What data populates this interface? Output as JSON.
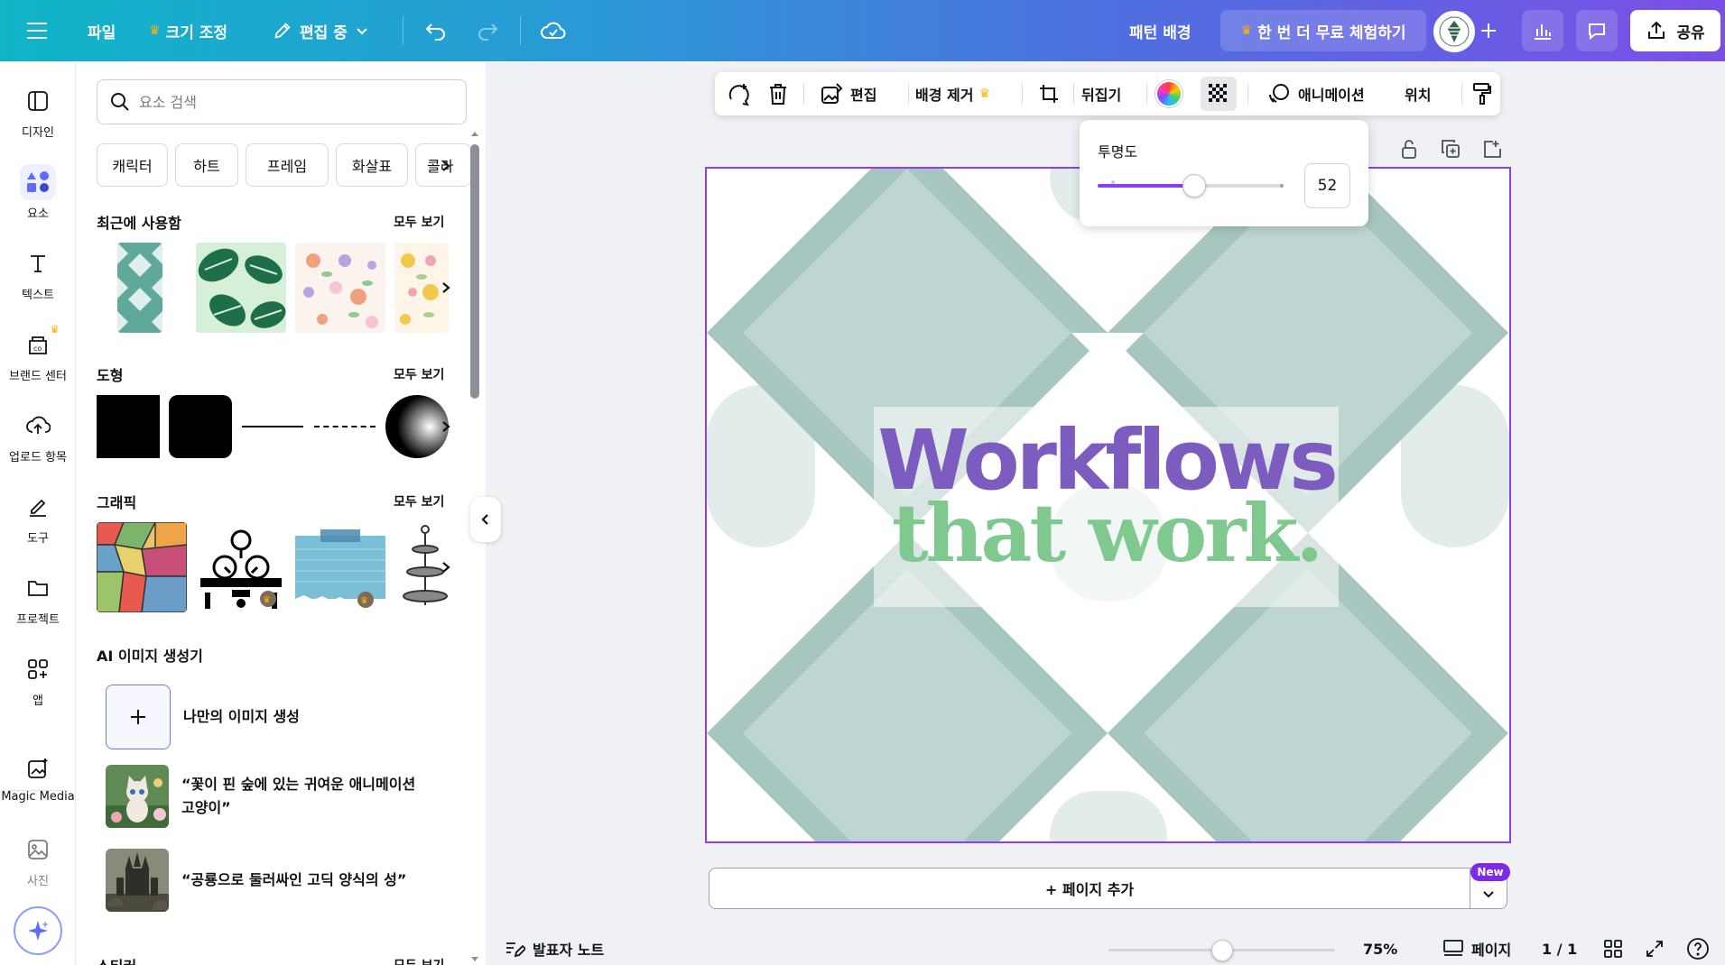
{
  "topbar": {
    "file": "파일",
    "resize": "크기 조정",
    "editing": "편집 중",
    "pattern_bg": "패턴 배경",
    "trial": "한 번 더 무료 체험하기",
    "share": "공유"
  },
  "rail": {
    "design": "디자인",
    "elements": "요소",
    "text": "텍스트",
    "brand": "브랜드 센터",
    "uploads": "업로드 항목",
    "tools": "도구",
    "projects": "프로젝트",
    "apps": "앱",
    "magic_media": "Magic Media",
    "photos": "사진"
  },
  "panel": {
    "search_placeholder": "요소 검색",
    "chips": [
      "캐릭터",
      "하트",
      "프레임",
      "화살표",
      "콜라"
    ],
    "recent": "최근에 사용함",
    "shapes": "도형",
    "graphics": "그래픽",
    "ai_generator": "AI 이미지 생성기",
    "stickers": "스티커",
    "see_all": "모두 보기",
    "ai_items": {
      "create": "나만의 이미지 생성",
      "prompt1_line1": "“꽃이 핀 숲에 있는 귀여운 애니메이션",
      "prompt1_line2": "고양이”",
      "prompt2": "“공룡으로 둘러싸인 고딕 양식의 성”"
    }
  },
  "ctx_toolbar": {
    "edit": "편집",
    "remove_bg": "배경 제거",
    "flip": "뒤집기",
    "animate": "애니메이션",
    "position": "위치"
  },
  "transparency": {
    "label": "투명도",
    "value": "52",
    "fraction": 0.52
  },
  "canvas": {
    "line1": "Workflows",
    "line2": "that work."
  },
  "add_page": {
    "label": "+ 페이지 추가",
    "badge": "New"
  },
  "bottom": {
    "notes": "발표자 노트",
    "zoom": "75%",
    "pages": "페이지",
    "page_count": "1 / 1"
  },
  "colors": {
    "accent": "#8b3dff",
    "headline_purple": "#7c5cbf",
    "headline_green": "#7fc890",
    "pattern_dark": "#a8c6c0",
    "pattern_light": "#c6dcd8"
  }
}
